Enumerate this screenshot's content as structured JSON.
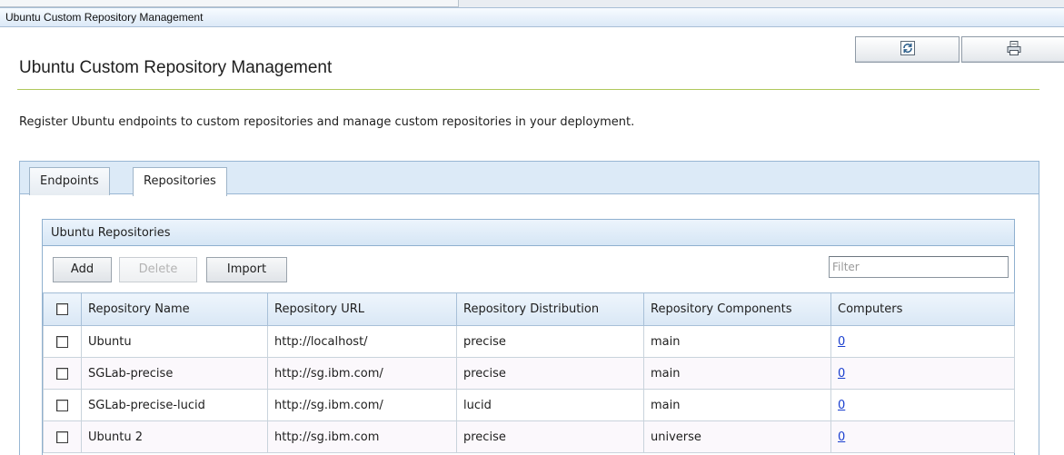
{
  "window": {
    "title": "Ubuntu Custom Repository Management"
  },
  "actions": {
    "refresh_icon": "refresh-icon",
    "print_icon": "print-icon"
  },
  "page": {
    "title": "Ubuntu Custom Repository Management",
    "description": "Register Ubuntu endpoints to custom repositories and manage custom repositories in your deployment."
  },
  "tabs": [
    {
      "label": "Endpoints",
      "selected": false
    },
    {
      "label": "Repositories",
      "selected": true
    }
  ],
  "repositories_panel": {
    "title": "Ubuntu Repositories",
    "toolbar": {
      "add_label": "Add",
      "delete_label": "Delete",
      "import_label": "Import"
    },
    "filter": {
      "placeholder": "Filter",
      "value": ""
    },
    "columns": [
      "Repository Name",
      "Repository URL",
      "Repository Distribution",
      "Repository Components",
      "Computers"
    ],
    "rows": [
      {
        "name": "Ubuntu",
        "url": "http://localhost/",
        "distribution": "precise",
        "components": "main",
        "computers": "0"
      },
      {
        "name": "SGLab-precise",
        "url": "http://sg.ibm.com/",
        "distribution": "precise",
        "components": "main",
        "computers": "0"
      },
      {
        "name": "SGLab-precise-lucid",
        "url": "http://sg.ibm.com/",
        "distribution": "lucid",
        "components": "main",
        "computers": "0"
      },
      {
        "name": "Ubuntu 2",
        "url": "http://sg.ibm.com",
        "distribution": "precise",
        "components": "universe",
        "computers": "0"
      }
    ]
  },
  "colors": {
    "accent_rule": "#b0c85c",
    "header_blue": "#d6e6f5",
    "link": "#1a3fcf"
  }
}
